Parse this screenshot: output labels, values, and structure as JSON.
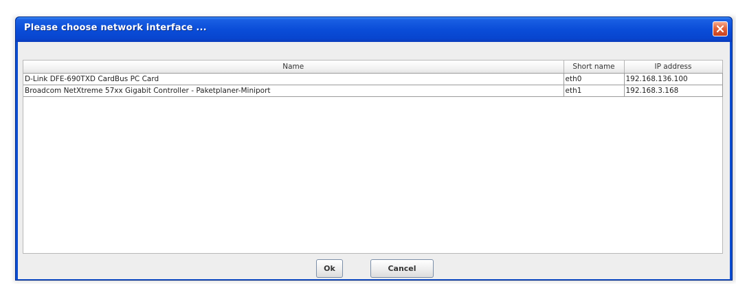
{
  "dialog": {
    "title": "Please choose network interface ...",
    "accent_color": "#0a4dd8",
    "close_icon": "close-icon"
  },
  "table": {
    "columns": [
      "Name",
      "Short name",
      "IP address"
    ],
    "rows": [
      {
        "name": "D-Link DFE-690TXD CardBus PC Card",
        "short_name": "eth0",
        "ip": "192.168.136.100"
      },
      {
        "name": "Broadcom NetXtreme 57xx Gigabit Controller - Paketplaner-Miniport",
        "short_name": "eth1",
        "ip": "192.168.3.168"
      }
    ]
  },
  "buttons": {
    "ok_label": "Ok",
    "cancel_label": "Cancel"
  }
}
